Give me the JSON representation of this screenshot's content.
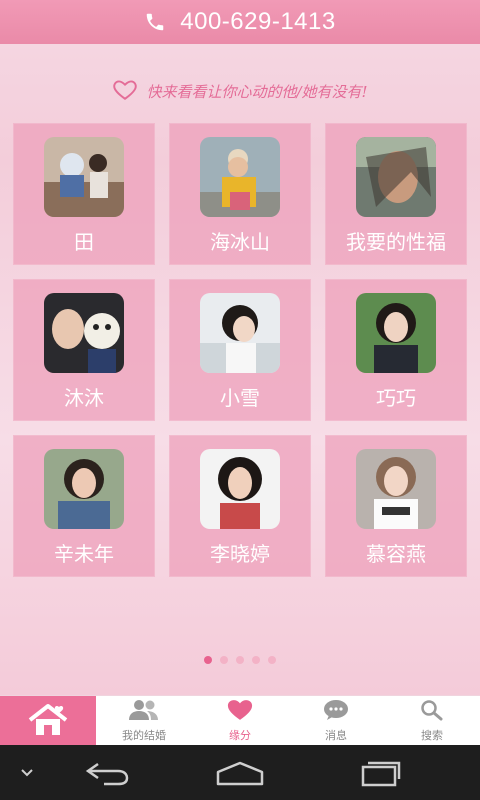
{
  "header": {
    "phone": "400-629-1413",
    "phone_icon": "phone-icon"
  },
  "tagline": "快来看看让你心动的他/她有没有!",
  "profiles": [
    {
      "name": "田"
    },
    {
      "name": "海冰山"
    },
    {
      "name": "我要的性福"
    },
    {
      "name": "沐沐"
    },
    {
      "name": "小雪"
    },
    {
      "name": "巧巧"
    },
    {
      "name": "辛未年"
    },
    {
      "name": "李晓婷"
    },
    {
      "name": "慕容燕"
    }
  ],
  "pager": {
    "count": 5,
    "active_index": 0
  },
  "tabs": [
    {
      "label": "",
      "icon": "home-icon",
      "active": true
    },
    {
      "label": "我的结婚",
      "icon": "people-icon"
    },
    {
      "label": "缘分",
      "icon": "heart-icon",
      "active": true
    },
    {
      "label": "消息",
      "icon": "chat-icon"
    },
    {
      "label": "搜索",
      "icon": "search-icon"
    }
  ],
  "colors": {
    "accent": "#e8628e",
    "header": "#f19ab6",
    "card": "#ee9fba"
  }
}
